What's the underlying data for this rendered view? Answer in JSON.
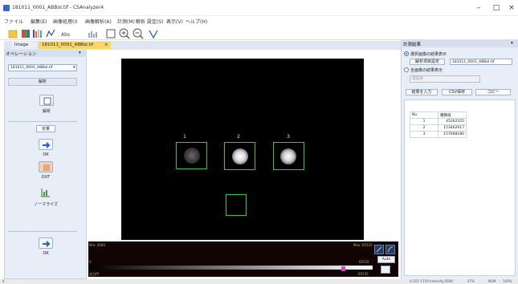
{
  "window": {
    "title": "181011_0001_ABBoI.tif - CSAnalyzer4",
    "minimize": "–",
    "maximize": "□",
    "close": "×"
  },
  "menu": [
    "ファイル",
    "編集(E)",
    "画像処理(I)",
    "画像解析(A)",
    "計測(M)",
    "解析",
    "設定(S)",
    "表示(V)",
    "ヘルプ(H)"
  ],
  "tabs": {
    "image_tab": "Image",
    "doc_tab": "181011_0001_ABBoI.tif",
    "doc_close": "×"
  },
  "left_panel": {
    "title": "オペレーション",
    "pin": "▾",
    "dropdown_value": "181011_0001_ABBoI.tif",
    "dropdown_arrow": "▾",
    "analyze_button": "解析",
    "analyze_icon_label": "解析",
    "section_label": "定量",
    "ok_label": "OK",
    "out_label": "OUT",
    "normalize_label": "ノーマライズ",
    "bottom_ok_label": "OK"
  },
  "image": {
    "roi_labels": [
      "1",
      "2",
      "3"
    ],
    "roi_intensity": [
      "dim",
      "bright",
      "bright"
    ]
  },
  "colorbar": {
    "min_label": "Min: 2600",
    "max_label": "Max: 65535",
    "left_value": "0",
    "right_value": "65535",
    "bottom_left": "全白門",
    "bottom_right": "65535",
    "auto_label": "Auto"
  },
  "right_panel": {
    "header_title": "計測結果",
    "header_pin": "▾",
    "radio_selected": "選択画像の結果表示",
    "analysis_settings_button": "解析項目設定",
    "image_select_value": "181011_0001_ABBoI.tif",
    "radio_all": "全画像の結果表示",
    "all_select_placeholder": "常設項",
    "buttons": [
      "結果を入力",
      "CSV保存",
      "コピー"
    ],
    "table": {
      "headers": [
        "No.",
        "積算値"
      ],
      "rows": [
        [
          "1",
          "45262105"
        ],
        [
          "2",
          "153462617"
        ],
        [
          "3",
          "157668186"
        ]
      ]
    }
  },
  "status": {
    "left": "4",
    "coords": "X:315 Y:150 Intensity:5608",
    "zoom": "47%",
    "mode": "NUM",
    "extra": "100%"
  },
  "colors": {
    "accent_blue": "#3a66c9",
    "roi_green": "#35c64a",
    "tab_active_yellow": "#f7d667",
    "panel_bg": "#e8eef7"
  },
  "icons": [
    "app-icon",
    "open-icon",
    "color-icon",
    "chart-icon",
    "abs-icon",
    "grid-icon",
    "zoom-fit-icon",
    "zoom-in-icon",
    "zoom-out-icon",
    "line-icon"
  ]
}
